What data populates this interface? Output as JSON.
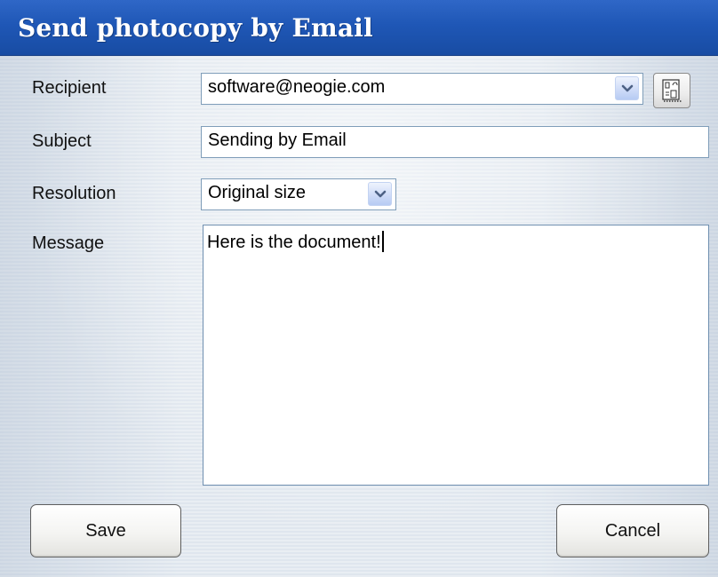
{
  "dialog": {
    "title": "Send photocopy by Email"
  },
  "form": {
    "recipient": {
      "label": "Recipient",
      "value": "software@neogie.com"
    },
    "subject": {
      "label": "Subject",
      "value": "Sending by Email"
    },
    "resolution": {
      "label": "Resolution",
      "value": "Original size"
    },
    "message": {
      "label": "Message",
      "value": "Here is the document!"
    }
  },
  "buttons": {
    "save_label": "Save",
    "cancel_label": "Cancel"
  },
  "icons": {
    "recipient_dropdown": "chevron-down-icon",
    "address_book": "address-book-icon",
    "resolution_dropdown": "chevron-down-icon"
  },
  "colors": {
    "title_bar": "#1f57b6",
    "field_border": "#7f9db9",
    "dropdown_chevron": "#4d6185"
  }
}
